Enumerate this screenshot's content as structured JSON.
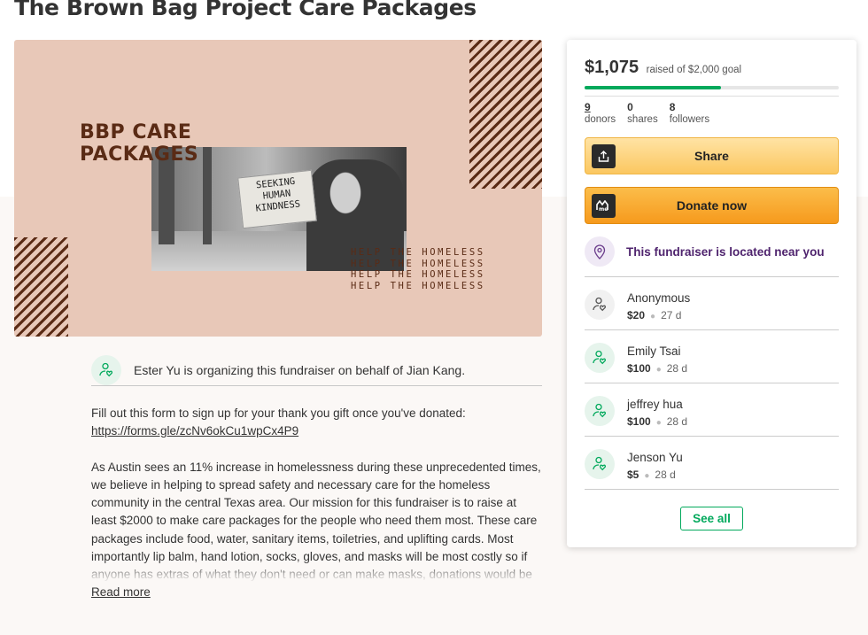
{
  "page": {
    "title": "The Brown Bag Project Care Packages"
  },
  "hero": {
    "headline_line1": "BBP CARE",
    "headline_line2": "PACKAGES",
    "sign_line1": "SEEKING",
    "sign_line2": "HUMAN",
    "sign_line3": "KINDNESS",
    "repeat_line": "HELP THE HOMELESS"
  },
  "organizer": {
    "text": "Ester Yu is organizing this fundraiser on behalf of Jian Kang."
  },
  "story": {
    "intro": "Fill out this form to sign up for your thank you gift once you've donated:",
    "link": "https://forms.gle/zcNv6okCu1wpCx4P9",
    "body": "As Austin sees an 11% increase in homelessness during these unprecedented times, we believe in helping to spread safety and necessary care for the homeless community in the central Texas area. Our mission for this fundraiser is to raise at least $2000 to make care packages for the people who need them most. These care packages include food, water, sanitary items, toiletries, and uplifting cards. Most importantly lip balm, hand lotion, socks, gloves, and masks will be most costly so if anyone has extras of what they don't need or can make masks, donations would be greatly appreciated. I",
    "read_more": "Read more"
  },
  "sidebar": {
    "amount": "$1,075",
    "goal_text": "raised of $2,000 goal",
    "progress_fraction": 0.5375,
    "stats": [
      {
        "value": "9",
        "label": "donors"
      },
      {
        "value": "0",
        "label": "shares"
      },
      {
        "value": "8",
        "label": "followers"
      }
    ],
    "share_label": "Share",
    "donate_label": "Donate now",
    "nearby_text": "This fundraiser is located near you",
    "donors": [
      {
        "name": "Anonymous",
        "amount": "$20",
        "time": "27 d"
      },
      {
        "name": "Emily Tsai",
        "amount": "$100",
        "time": "28 d"
      },
      {
        "name": "jeffrey hua",
        "amount": "$100",
        "time": "28 d"
      },
      {
        "name": "Jenson Yu",
        "amount": "$5",
        "time": "28 d"
      }
    ],
    "see_all_label": "See all"
  },
  "colors": {
    "accent_green": "#02a95c",
    "share_yellow": "#fbc760",
    "donate_orange": "#f69a1d",
    "nearby_purple": "#4f246e",
    "hero_bg": "#e8c8b8",
    "hero_brown": "#5a2b15"
  },
  "icons": {
    "organizer": "hand-heart-icon",
    "share": "share-upload-icon",
    "donate": "gofundme-logo-icon",
    "location": "location-pin-icon",
    "donor": "hand-heart-icon"
  }
}
